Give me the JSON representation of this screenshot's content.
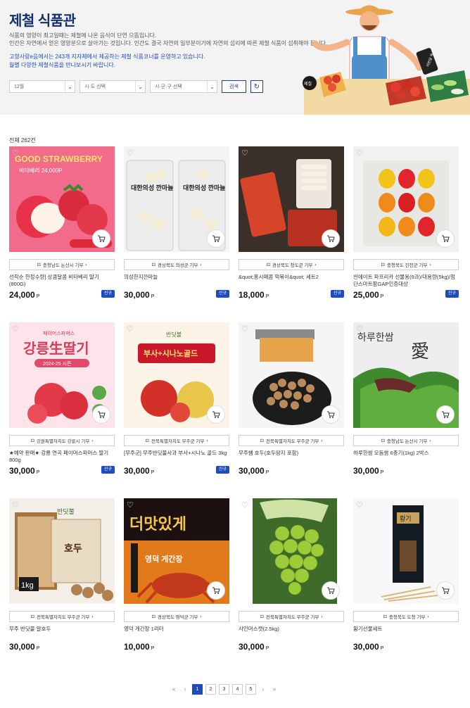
{
  "hero": {
    "title": "제철 식품관",
    "desc1": "식품의 영양이 최고일때는 제철에 나온 음식이 단연 으뜸입니다.",
    "desc2": "인간은 자연에서 얻은 영양분으로 살아가는 것입니다. 인간도 결국 자연의 일부분이기에 자연의 섭리에 따른 제철 식품이 섭취해야 됩니다.",
    "desc3": "고향사랑e음에서는 243개 지자체에서 제공하는 제철 식품코너를 운영하고 있습니다.",
    "desc4": "월별 다양한 제철식품을 만나보시기 바랍니다.",
    "sign_label": "이번달 제스",
    "badge_label": "제철"
  },
  "filters": {
    "month": "12월",
    "sido": "시·도 선택",
    "sigungu": "시·군·구 선택",
    "search_label": "검색"
  },
  "total_label": "전체 262건",
  "products": [
    {
      "region": "충청남도 논산시 기부",
      "name": "선착순 한정수량] 상큼달콤 비타베리 딸기(800G)",
      "price": "24,000",
      "badge": "신규"
    },
    {
      "region": "경상북도 의성군 기부",
      "name": "의성한지깐마늘",
      "price": "30,000",
      "badge": "신규"
    },
    {
      "region": "경상북도 청도군 기부",
      "name": "&quot;홍시매콤 떡볶이&quot; 세트2",
      "price": "18,000",
      "badge": "신규"
    },
    {
      "region": "충청북도 진천군 기부",
      "name": "씬에이트 파프리카 선물용(9과)/대용량(5kg)/첨단스마트팜GAP인증대상",
      "price": "25,000",
      "badge": "신규"
    },
    {
      "region": "강원특별자치도 강릉시 기부",
      "name": "★예약 판매★ 강릉 연곡 페이머스파머스 딸기 800g",
      "price": "30,000",
      "badge": "신규"
    },
    {
      "region": "전북특별자치도 무주군 기부",
      "name": "[무주군] 무주반딧불사과 부사+시나노 골드 3kg",
      "price": "30,000",
      "badge": "신규"
    },
    {
      "region": "전북특별자치도 무주군 기부",
      "name": "무주쌤 호두(호두땅지 포함)",
      "price": "30,000",
      "badge": ""
    },
    {
      "region": "충청남도 논산시 기부",
      "name": "하루한쌈 모듬쌈 6종기(1kg) 2박스",
      "price": "30,000",
      "badge": ""
    },
    {
      "region": "전북특별자치도 무주군 기부",
      "name": "무주 반딧불 알호두",
      "price": "30,000",
      "badge": ""
    },
    {
      "region": "경상북도 영덕군 기부",
      "name": "영덕 게간장 1리터",
      "price": "10,000",
      "badge": ""
    },
    {
      "region": "전북특별자치도 무주군 기부",
      "name": "샤인머스캣(2.5kg)",
      "price": "30,000",
      "badge": ""
    },
    {
      "region": "충청북도 도청 기부",
      "name": "황기선물세트",
      "price": "30,000",
      "badge": ""
    }
  ],
  "thumb_text": {
    "t1a": "GOOD STRAWBERRY",
    "t1b": "비타베리 24,000P",
    "t2": "대한의성 깐마늘",
    "t5a": "페이머스파머스",
    "t5b": "강릉生딸기",
    "t5c": "2024-25 시즌",
    "t6a": "반딧불",
    "t6b": "부사+시나노골드",
    "t8a": "하루한쌈",
    "t8b": "愛",
    "t9a": "호두",
    "t9b": "1kg",
    "t10a": "더맛있게",
    "t10b": "영덕 게간장",
    "t12": "황기"
  },
  "price_unit": "P",
  "pagination": {
    "pages": [
      "1",
      "2",
      "3",
      "4",
      "5"
    ],
    "current": "1"
  },
  "colors": {
    "brand": "#132e6e",
    "accent": "#1e4bbd"
  }
}
